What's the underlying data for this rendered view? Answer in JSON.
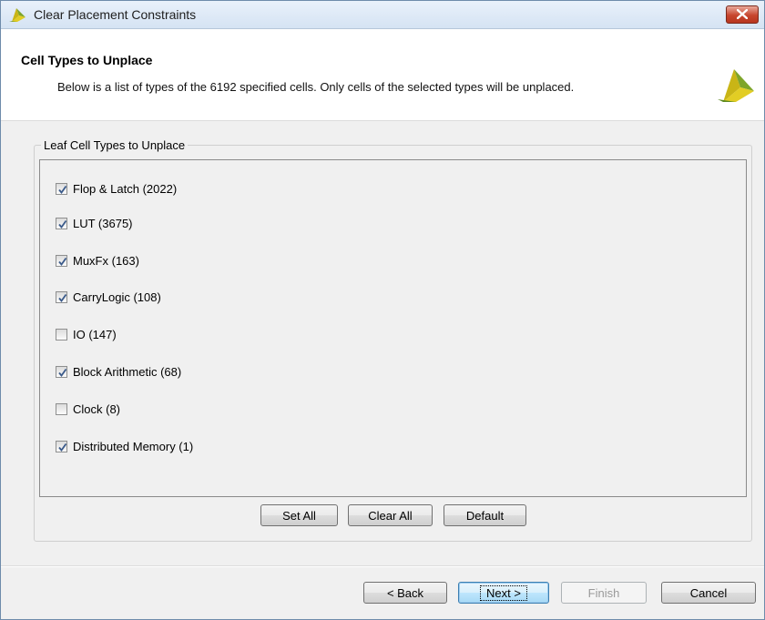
{
  "window": {
    "title": "Clear Placement Constraints",
    "close_label": "close"
  },
  "header": {
    "title": "Cell Types to Unplace",
    "description": "Below is a list of types of the 6192 specified cells. Only cells of the selected types will be unplaced."
  },
  "group": {
    "legend": "Leaf Cell Types to Unplace",
    "items": [
      {
        "label": "Flop & Latch (2022)",
        "checked": true
      },
      {
        "label": "LUT (3675)",
        "checked": true
      },
      {
        "label": "MuxFx (163)",
        "checked": true
      },
      {
        "label": "CarryLogic (108)",
        "checked": true
      },
      {
        "label": "IO (147)",
        "checked": false
      },
      {
        "label": "Block Arithmetic (68)",
        "checked": true
      },
      {
        "label": "Clock (8)",
        "checked": false
      },
      {
        "label": "Distributed Memory (1)",
        "checked": true
      }
    ],
    "buttons": {
      "set_all": "Set All",
      "clear_all": "Clear All",
      "default": "Default"
    }
  },
  "footer": {
    "back": "< Back",
    "next": "Next >",
    "finish": "Finish",
    "cancel": "Cancel"
  },
  "icons": {
    "app_logo": "vivado-logo-icon",
    "close": "close-icon",
    "check": "checkmark-icon"
  },
  "colors": {
    "logo_yellow": "#d9c21a",
    "logo_green": "#6e9a24",
    "close_red": "#c7452d",
    "primary_border": "#3c7fb1"
  }
}
